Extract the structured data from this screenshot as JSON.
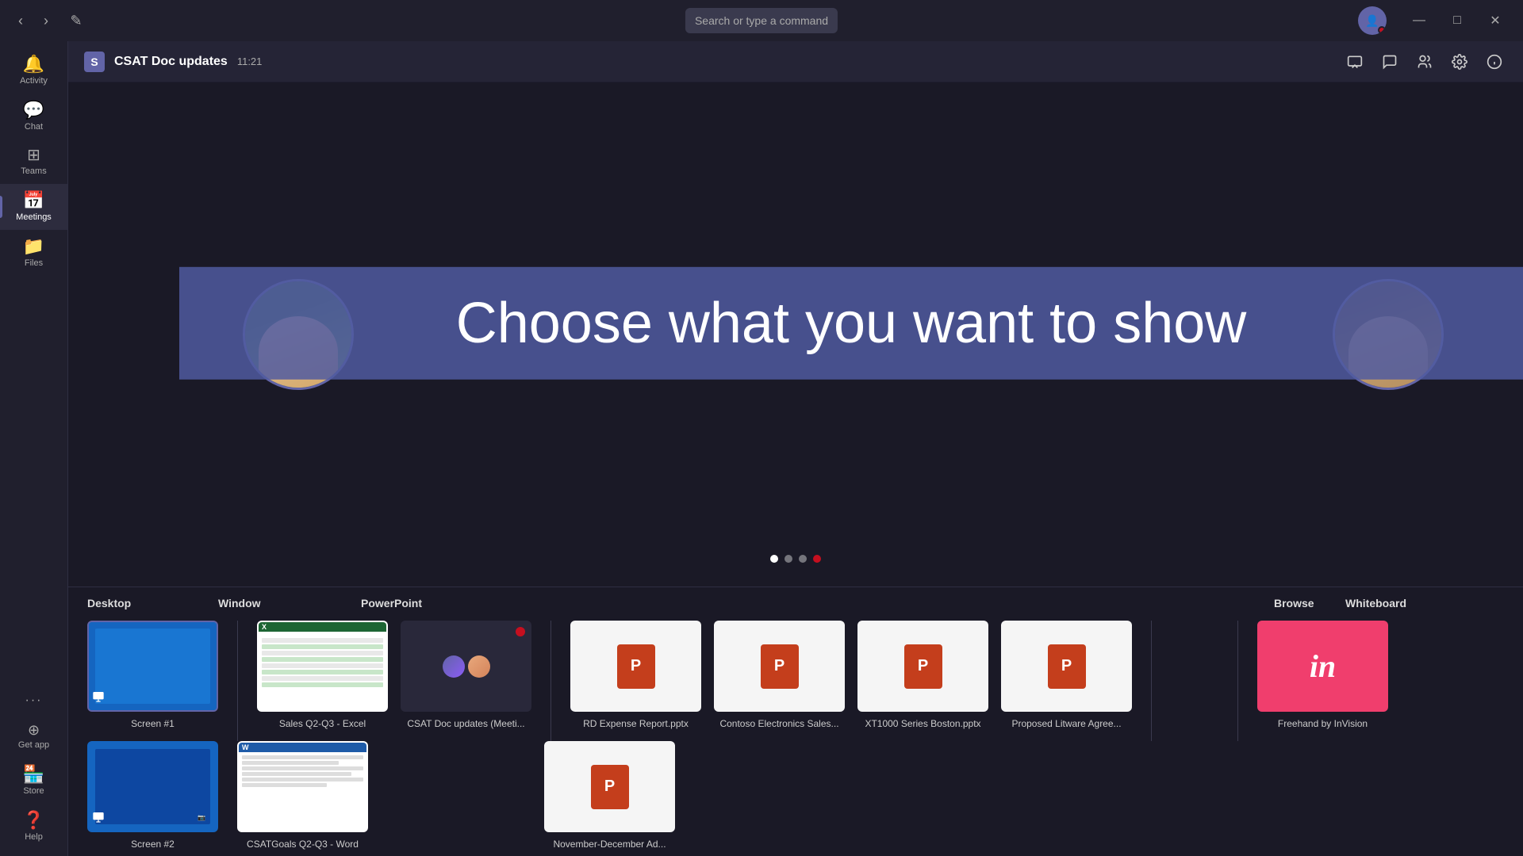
{
  "titlebar": {
    "back_label": "‹",
    "forward_label": "›",
    "compose_label": "✎",
    "search_placeholder": "Search or type a command",
    "minimize_label": "—",
    "maximize_label": "□",
    "close_label": "✕"
  },
  "sidebar": {
    "items": [
      {
        "id": "activity",
        "label": "Activity",
        "icon": "🔔",
        "active": false
      },
      {
        "id": "chat",
        "label": "Chat",
        "icon": "💬",
        "active": false
      },
      {
        "id": "teams",
        "label": "Teams",
        "icon": "⊞",
        "active": false
      },
      {
        "id": "meetings",
        "label": "Meetings",
        "icon": "📅",
        "active": true
      },
      {
        "id": "files",
        "label": "Files",
        "icon": "📁",
        "active": false
      }
    ],
    "bottom_items": [
      {
        "id": "get-app",
        "label": "Get app",
        "icon": "⬇"
      },
      {
        "id": "store",
        "label": "Store",
        "icon": "🏪"
      },
      {
        "id": "help",
        "label": "Help",
        "icon": "❓"
      },
      {
        "id": "more",
        "label": "...",
        "icon": "···"
      }
    ]
  },
  "meeting": {
    "logo": "S",
    "title": "CSAT Doc updates",
    "time": "11:21",
    "header_actions": [
      {
        "id": "share-screen",
        "icon": "⬜"
      },
      {
        "id": "chat",
        "icon": "💬"
      },
      {
        "id": "participants",
        "icon": "👥"
      },
      {
        "id": "more-options",
        "icon": "⚙"
      },
      {
        "id": "info",
        "icon": "ℹ"
      }
    ]
  },
  "banner": {
    "text": "Choose what you want to show"
  },
  "share_panel": {
    "categories": [
      {
        "id": "desktop",
        "label": "Desktop"
      },
      {
        "id": "window",
        "label": "Window"
      },
      {
        "id": "powerpoint",
        "label": "PowerPoint"
      },
      {
        "id": "browse",
        "label": "Browse"
      },
      {
        "id": "whiteboard",
        "label": "Whiteboard"
      }
    ],
    "desktop_items": [
      {
        "id": "screen1",
        "label": "Screen #1",
        "selected": true
      },
      {
        "id": "screen2",
        "label": "Screen #2",
        "selected": false
      }
    ],
    "window_items": [
      {
        "id": "sales-excel",
        "label": "Sales Q2-Q3 - Excel"
      },
      {
        "id": "csat-meeting",
        "label": "CSAT Doc updates (Meeti..."
      }
    ],
    "powerpoint_items": [
      {
        "id": "rd-expense",
        "label": "RD Expense Report.pptx"
      },
      {
        "id": "contoso-sales",
        "label": "Contoso Electronics Sales..."
      },
      {
        "id": "xt1000",
        "label": "XT1000 Series Boston.pptx"
      },
      {
        "id": "litware",
        "label": "Proposed Litware Agree..."
      },
      {
        "id": "november-ad",
        "label": "November-December Ad..."
      }
    ],
    "whiteboard_items": [
      {
        "id": "freehand",
        "label": "Freehand by InVision"
      }
    ]
  }
}
